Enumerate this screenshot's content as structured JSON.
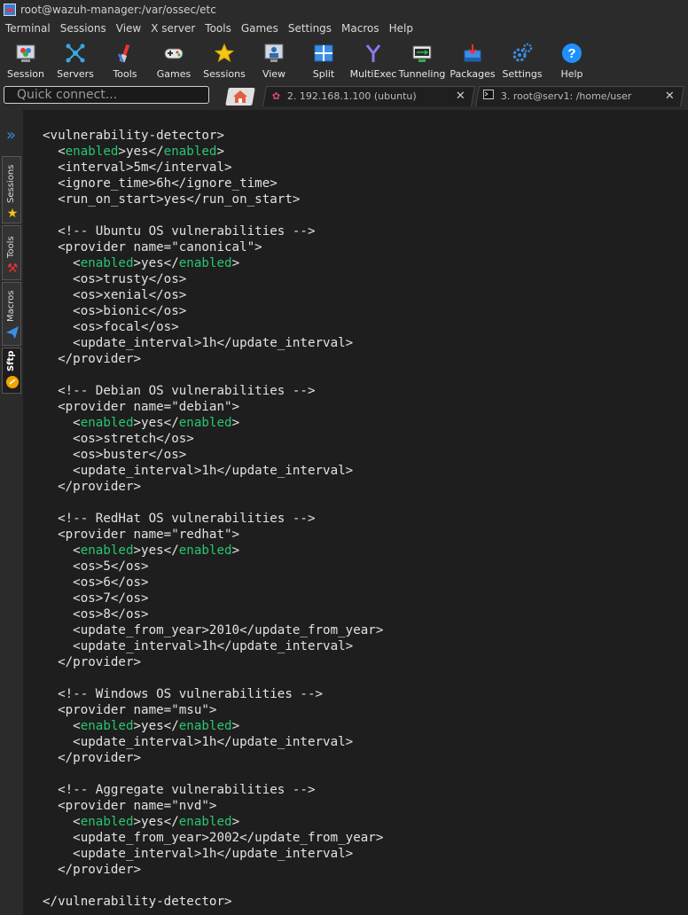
{
  "window": {
    "title": "root@wazuh-manager:/var/ossec/etc"
  },
  "menu": [
    "Terminal",
    "Sessions",
    "View",
    "X server",
    "Tools",
    "Games",
    "Settings",
    "Macros",
    "Help"
  ],
  "toolbar": [
    {
      "label": "Session",
      "icon": "session-icon"
    },
    {
      "label": "Servers",
      "icon": "servers-icon"
    },
    {
      "label": "Tools",
      "icon": "tools-icon"
    },
    {
      "label": "Games",
      "icon": "games-icon"
    },
    {
      "label": "Sessions",
      "icon": "star-icon"
    },
    {
      "label": "View",
      "icon": "view-icon"
    },
    {
      "label": "Split",
      "icon": "split-icon"
    },
    {
      "label": "MultiExec",
      "icon": "multiexec-icon"
    },
    {
      "label": "Tunneling",
      "icon": "tunneling-icon"
    },
    {
      "label": "Packages",
      "icon": "packages-icon"
    },
    {
      "label": "Settings",
      "icon": "settings-icon"
    },
    {
      "label": "Help",
      "icon": "help-icon"
    }
  ],
  "quick_connect": {
    "placeholder": "Quick connect..."
  },
  "tabs": [
    {
      "label": "2. 192.168.1.100 (ubuntu)",
      "icon": "raspberry-icon"
    },
    {
      "label": "3. root@serv1: /home/user",
      "icon": "terminal-icon"
    }
  ],
  "side_tabs": [
    "Sessions",
    "Tools",
    "Macros",
    "Sftp"
  ],
  "terminal": {
    "lines": [
      "<vulnerability-detector>",
      "  <enabled>yes</enabled>",
      "  <interval>5m</interval>",
      "  <ignore_time>6h</ignore_time>",
      "  <run_on_start>yes</run_on_start>",
      "",
      "  <!-- Ubuntu OS vulnerabilities -->",
      "  <provider name=\"canonical\">",
      "    <enabled>yes</enabled>",
      "    <os>trusty</os>",
      "    <os>xenial</os>",
      "    <os>bionic</os>",
      "    <os>focal</os>",
      "    <update_interval>1h</update_interval>",
      "  </provider>",
      "",
      "  <!-- Debian OS vulnerabilities -->",
      "  <provider name=\"debian\">",
      "    <enabled>yes</enabled>",
      "    <os>stretch</os>",
      "    <os>buster</os>",
      "    <update_interval>1h</update_interval>",
      "  </provider>",
      "",
      "  <!-- RedHat OS vulnerabilities -->",
      "  <provider name=\"redhat\">",
      "    <enabled>yes</enabled>",
      "    <os>5</os>",
      "    <os>6</os>",
      "    <os>7</os>",
      "    <os>8</os>",
      "    <update_from_year>2010</update_from_year>",
      "    <update_interval>1h</update_interval>",
      "  </provider>",
      "",
      "  <!-- Windows OS vulnerabilities -->",
      "  <provider name=\"msu\">",
      "    <enabled>yes</enabled>",
      "    <update_interval>1h</update_interval>",
      "  </provider>",
      "",
      "  <!-- Aggregate vulnerabilities -->",
      "  <provider name=\"nvd\">",
      "    <enabled>yes</enabled>",
      "    <update_from_year>2002</update_from_year>",
      "    <update_interval>1h</update_interval>",
      "  </provider>",
      "",
      "</vulnerability-detector>"
    ],
    "highlight_color": "#27c76f",
    "text_color": "#e2e2e2",
    "background": "#1e1e1e"
  }
}
